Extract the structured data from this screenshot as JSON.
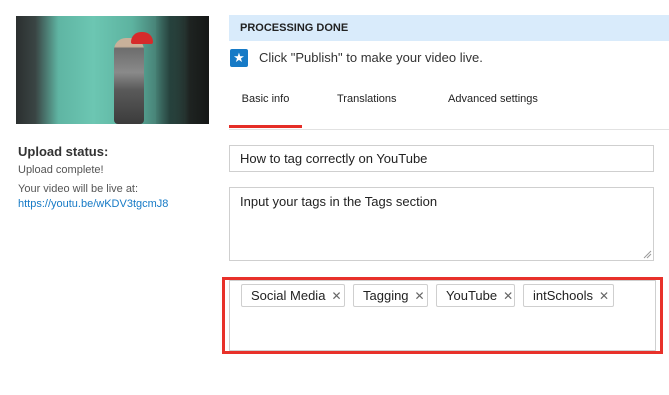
{
  "left": {
    "upload_status_title": "Upload status:",
    "upload_complete": "Upload complete!",
    "live_at": "Your video will be live at:",
    "live_link": "https://youtu.be/wKDV3tgcmJ8"
  },
  "processing": {
    "banner": "PROCESSING DONE",
    "publish_msg": "Click \"Publish\" to make your video live.",
    "icon": "star-icon"
  },
  "tabs": [
    {
      "label": "Basic info",
      "active": true
    },
    {
      "label": "Translations",
      "active": false
    },
    {
      "label": "Advanced settings",
      "active": false
    }
  ],
  "form": {
    "title_value": "How to tag correctly on YouTube",
    "description_value": "Input your tags in the Tags section",
    "tags": [
      "Social Media",
      "Tagging",
      "YouTube",
      "intSchools"
    ],
    "remove_icon": "close-icon"
  },
  "colors": {
    "accent_red": "#e8312a",
    "link_blue": "#167ac6",
    "banner_blue": "#d9ebfb"
  }
}
